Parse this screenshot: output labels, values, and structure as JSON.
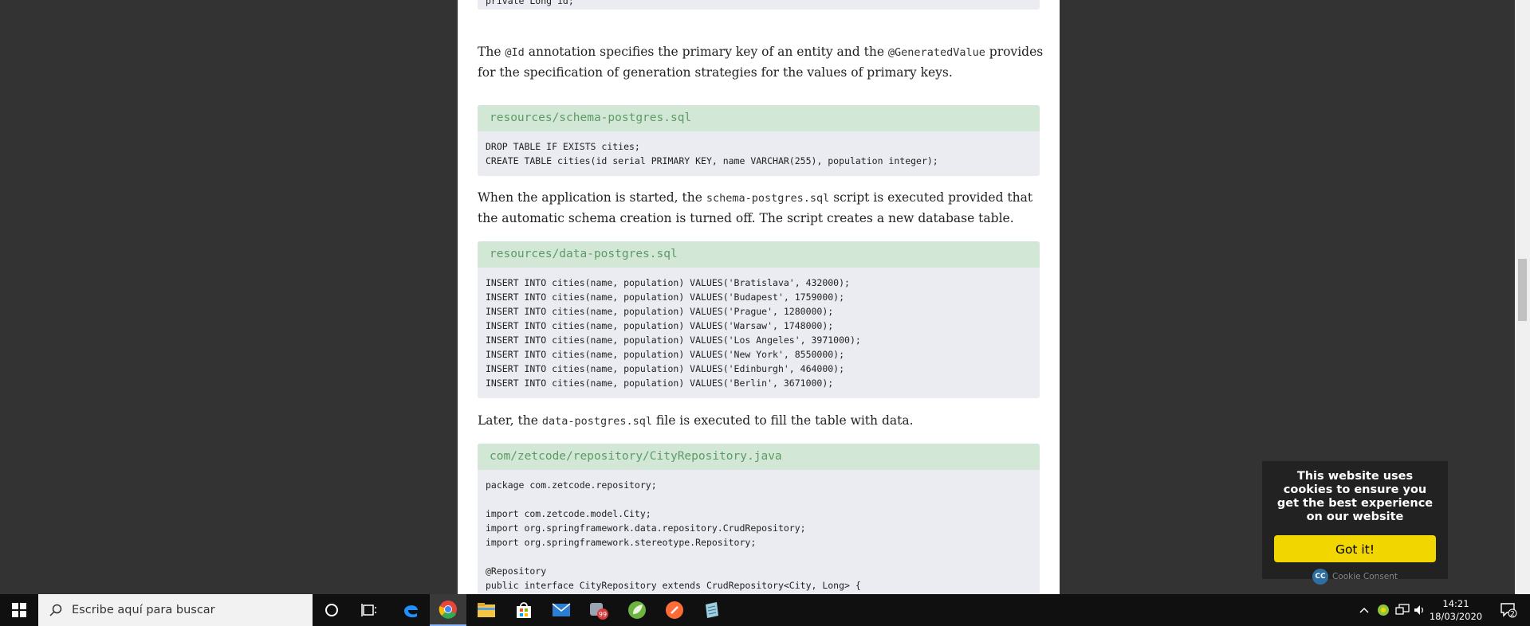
{
  "article": {
    "top_code_fragment": "private Long id;",
    "para1": {
      "t1": "The ",
      "c1": "@Id",
      "t2": " annotation specifies the primary key of an entity and the ",
      "c2": "@GeneratedValue",
      "t3": " provides for the specification of generation strategies for the values of primary keys."
    },
    "schema": {
      "caption": "resources/schema-postgres.sql",
      "lines": [
        "DROP TABLE IF EXISTS cities;",
        "CREATE TABLE cities(id serial PRIMARY KEY, name VARCHAR(255), population integer);"
      ]
    },
    "para2": {
      "t1": "When the application is started, the ",
      "c1": "schema-postgres.sql",
      "t2": " script is executed provided that the automatic schema creation is turned off. The script creates a new database table."
    },
    "data_sql": {
      "caption": "resources/data-postgres.sql",
      "lines": [
        "INSERT INTO cities(name, population) VALUES('Bratislava', 432000);",
        "INSERT INTO cities(name, population) VALUES('Budapest', 1759000);",
        "INSERT INTO cities(name, population) VALUES('Prague', 1280000);",
        "INSERT INTO cities(name, population) VALUES('Warsaw', 1748000);",
        "INSERT INTO cities(name, population) VALUES('Los Angeles', 3971000);",
        "INSERT INTO cities(name, population) VALUES('New York', 8550000);",
        "INSERT INTO cities(name, population) VALUES('Edinburgh', 464000);",
        "INSERT INTO cities(name, population) VALUES('Berlin', 3671000);"
      ]
    },
    "para3": {
      "t1": "Later, the ",
      "c1": "data-postgres.sql",
      "t2": " file is executed to fill the table with data."
    },
    "repo": {
      "caption": "com/zetcode/repository/CityRepository.java",
      "lines": [
        "package com.zetcode.repository;",
        "",
        "import com.zetcode.model.City;",
        "import org.springframework.data.repository.CrudRepository;",
        "import org.springframework.stereotype.Repository;",
        "",
        "@Repository",
        "public interface CityRepository extends CrudRepository<City, Long> {"
      ]
    }
  },
  "cookie": {
    "message": "This website uses cookies to ensure you get the best experience on our website",
    "button": "Got it!",
    "brand_logo": "CC",
    "brand_label": "Cookie Consent"
  },
  "taskbar": {
    "search_placeholder": "Escribe aquí para buscar",
    "apps": [
      {
        "name": "edge-icon",
        "color": "#1e90ff"
      },
      {
        "name": "chrome-icon",
        "color": "#e8453c"
      },
      {
        "name": "file-explorer-icon",
        "color": "#f4c542"
      },
      {
        "name": "store-icon",
        "color": "#ffffff"
      },
      {
        "name": "mail-icon",
        "color": "#2d7dd2"
      },
      {
        "name": "app-badge-icon",
        "color": "#9aa4b2"
      },
      {
        "name": "spring-icon",
        "color": "#6db33f"
      },
      {
        "name": "postman-icon",
        "color": "#ff6c37"
      },
      {
        "name": "notes-icon",
        "color": "#9ccfe0"
      }
    ],
    "badge_count": "99",
    "clock_time": "14:21",
    "clock_date": "18/03/2020",
    "notification_count": "2"
  }
}
